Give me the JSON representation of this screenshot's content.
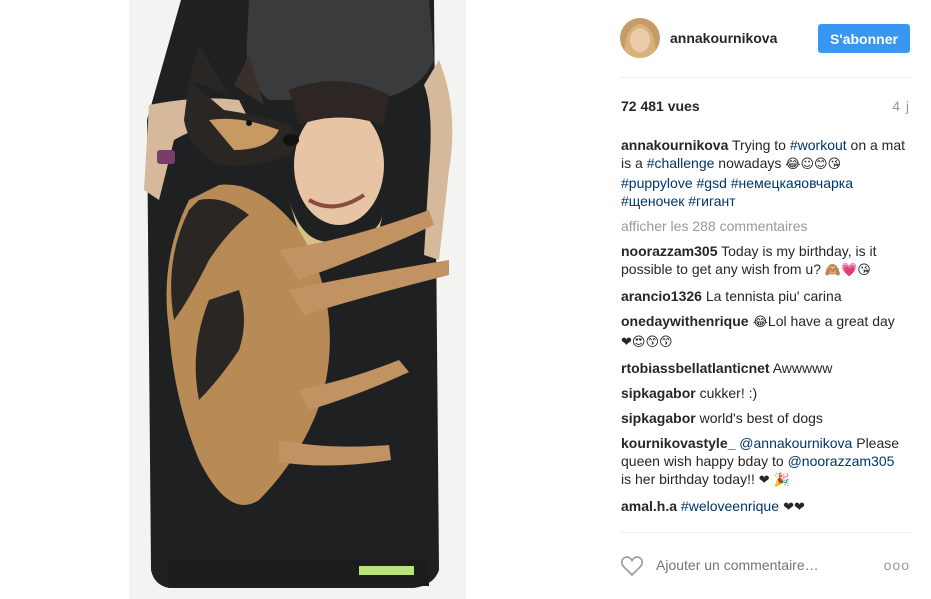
{
  "post": {
    "username": "annakournikova",
    "follow_label": "S'abonner",
    "views": "72 481 vues",
    "age": "4 j"
  },
  "caption": {
    "author": "annakournikova",
    "text_1": " Trying to ",
    "tag_workout": "#workout",
    "text_2": " on a mat is a ",
    "tag_challenge": "#challenge",
    "text_3": " nowadays ",
    "emoji": "😂☺😊😘",
    "tag_puppylove": "#puppylove",
    "tag_gsd": "#gsd",
    "tag_ovcharka": "#немецкаяовчарка",
    "tag_shchenochek": "#щеночек",
    "tag_gigant": "#гигант"
  },
  "show_more": "afficher les 288 commentaires",
  "comments": [
    {
      "author": "noorazzam305",
      "text": " Today is my birthday, is it possible to get any wish from u? ",
      "emoji": "🙈💗😘"
    },
    {
      "author": "arancio1326",
      "text": " La tennista piu' carina"
    },
    {
      "author": "onedaywithenrique",
      "emoji_pre": " 😂",
      "text": "Lol have a great day ",
      "emoji": "❤😍😙😙"
    },
    {
      "author": "rtobiassbellatlanticnet",
      "text": " Awwwww"
    },
    {
      "author": "sipkagabor",
      "text": " cukker! :)"
    },
    {
      "author": "sipkagabor",
      "text": " world's best of dogs"
    },
    {
      "author": "kournikovastyle_",
      "mention_1": "@annakournikova",
      "text_1": " Please queen wish happy bday to ",
      "mention_2": "@noorazzam305",
      "text_2": " is her birthday today!! ",
      "emoji": "❤ 🎉"
    },
    {
      "author": "amal.h.a",
      "tag": "#weloveenrique",
      "emoji": " ❤❤"
    }
  ],
  "footer": {
    "add_comment_placeholder": "Ajouter un commentaire…",
    "more_label": "ooo"
  },
  "icons": {
    "heart": "heart-icon",
    "more": "more-options-icon"
  },
  "colors": {
    "follow_button": "#3897f0",
    "hashtag": "#003569",
    "muted_text": "#999999"
  }
}
